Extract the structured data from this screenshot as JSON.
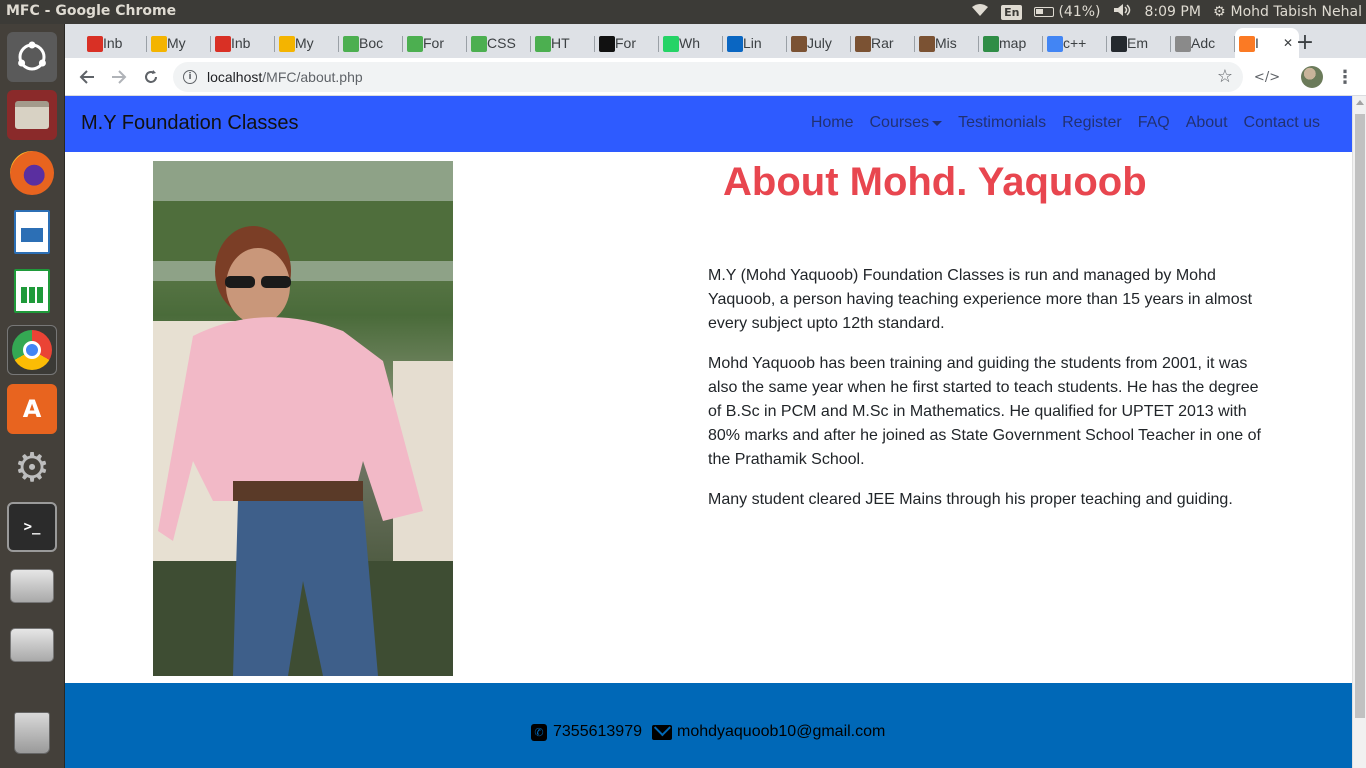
{
  "system": {
    "window_title": "MFC - Google Chrome",
    "keyboard_layout": "En",
    "battery": "(41%)",
    "time": "8:09 PM",
    "user": "Mohd Tabish Nehal"
  },
  "launcher": {
    "items": [
      {
        "name": "dash-icon",
        "color": "#6b6b6b"
      },
      {
        "name": "files-icon",
        "color": "#b8b0a0"
      },
      {
        "name": "firefox-icon",
        "color": "#e8641f"
      },
      {
        "name": "writer-icon",
        "color": "#2c6fb5"
      },
      {
        "name": "calc-icon",
        "color": "#1f9a3a"
      },
      {
        "name": "chrome-icon",
        "color": "#3b82d6"
      },
      {
        "name": "software-center-icon",
        "color": "#e8641f"
      },
      {
        "name": "system-settings-icon",
        "color": "#8a8a8a"
      },
      {
        "name": "terminal-icon",
        "color": "#2b2b2b"
      },
      {
        "name": "drive-icon",
        "color": "#bdbdbd"
      },
      {
        "name": "drive-icon-2",
        "color": "#bdbdbd"
      },
      {
        "name": "trash-icon",
        "color": "#9a9a9a"
      }
    ]
  },
  "tabs": [
    {
      "label": "Inb",
      "favicon": "gmail-icon",
      "color": "#d93025"
    },
    {
      "label": "My",
      "favicon": "drive-icon",
      "color": "#f4b400"
    },
    {
      "label": "Inb",
      "favicon": "gmail-icon",
      "color": "#d93025"
    },
    {
      "label": "My",
      "favicon": "drive-icon",
      "color": "#f4b400"
    },
    {
      "label": "Boc",
      "favicon": "w3schools-icon",
      "color": "#4caf50"
    },
    {
      "label": "For",
      "favicon": "w3schools-icon",
      "color": "#4caf50"
    },
    {
      "label": "CSS",
      "favicon": "w3schools-icon",
      "color": "#4caf50"
    },
    {
      "label": "HT",
      "favicon": "w3schools-icon",
      "color": "#4caf50"
    },
    {
      "label": "For",
      "favicon": "flag-icon",
      "color": "#111111"
    },
    {
      "label": "Wh",
      "favicon": "whatsapp-icon",
      "color": "#25d366"
    },
    {
      "label": "Lin",
      "favicon": "linkedin-icon",
      "color": "#0a66c2"
    },
    {
      "label": "July",
      "favicon": "codechef-icon",
      "color": "#7b5233"
    },
    {
      "label": "Rar",
      "favicon": "codechef-icon",
      "color": "#7b5233"
    },
    {
      "label": "Mis",
      "favicon": "codechef-icon",
      "color": "#7b5233"
    },
    {
      "label": "map",
      "favicon": "geeks-icon",
      "color": "#2f8d46"
    },
    {
      "label": "c++",
      "favicon": "google-icon",
      "color": "#4285f4"
    },
    {
      "label": "Em",
      "favicon": "github-icon",
      "color": "#24292e"
    },
    {
      "label": "Adc",
      "favicon": "bookmark-icon",
      "color": "#8a8a8a"
    },
    {
      "label": "I",
      "favicon": "xampp-icon",
      "color": "#fb7a24",
      "active": true
    }
  ],
  "address_bar": {
    "host": "localhost",
    "path": "/MFC/about.php"
  },
  "page": {
    "brand": "M.Y Foundation Classes",
    "nav": [
      "Home",
      "Courses",
      "Testimonials",
      "Register",
      "FAQ",
      "About",
      "Contact us"
    ],
    "title": "About Mohd. Yaquoob",
    "paragraphs": [
      "M.Y (Mohd Yaquoob) Foundation Classes is run and managed by Mohd Yaquoob, a person having teaching experience more than 15 years in almost every subject upto 12th standard.",
      "Mohd Yaquoob has been training and guiding the students from 2001, it was also the same year when he first started to teach students. He has the degree of B.Sc in PCM and M.Sc in Mathematics. He qualified for UPTET 2013 with 80% marks and after he joined as State Government School Teacher in one of the Prathamik School.",
      "Many student cleared JEE Mains through his proper teaching and guiding."
    ],
    "phone": "7355613979",
    "email": "mohdyaquoob10@gmail.com"
  },
  "colors": {
    "navbar": "#2e5bff",
    "title": "#e8464f",
    "footer": "#0068b7"
  }
}
